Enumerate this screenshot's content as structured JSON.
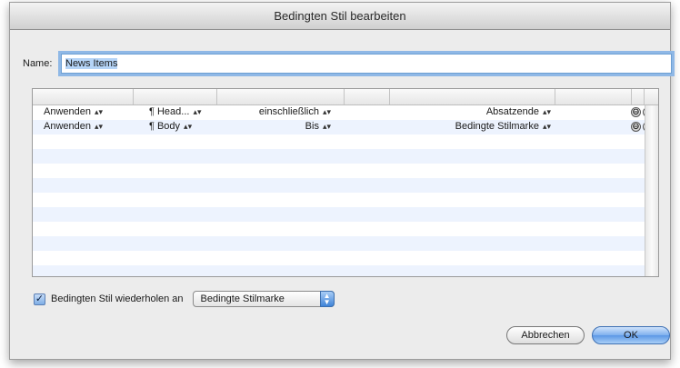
{
  "window": {
    "title": "Bedingten Stil bearbeiten"
  },
  "name_field": {
    "label": "Name:",
    "value": "News Items"
  },
  "table": {
    "rows": [
      {
        "action": "Anwenden",
        "style": "Head...",
        "inclusion": "einschließlich",
        "marker": "Absatzende",
        "remove": "⊖",
        "add": "⊕"
      },
      {
        "action": "Anwenden",
        "style": "Body",
        "inclusion": "Bis",
        "marker": "Bedingte Stilmarke",
        "remove": "⊖",
        "add": "⊕"
      }
    ]
  },
  "repeat": {
    "checked": true,
    "check_glyph": "✓",
    "label": "Bedingten Stil wiederholen an",
    "select_value": "Bedingte Stilmarke"
  },
  "buttons": {
    "cancel": "Abbrechen",
    "ok": "OK"
  }
}
